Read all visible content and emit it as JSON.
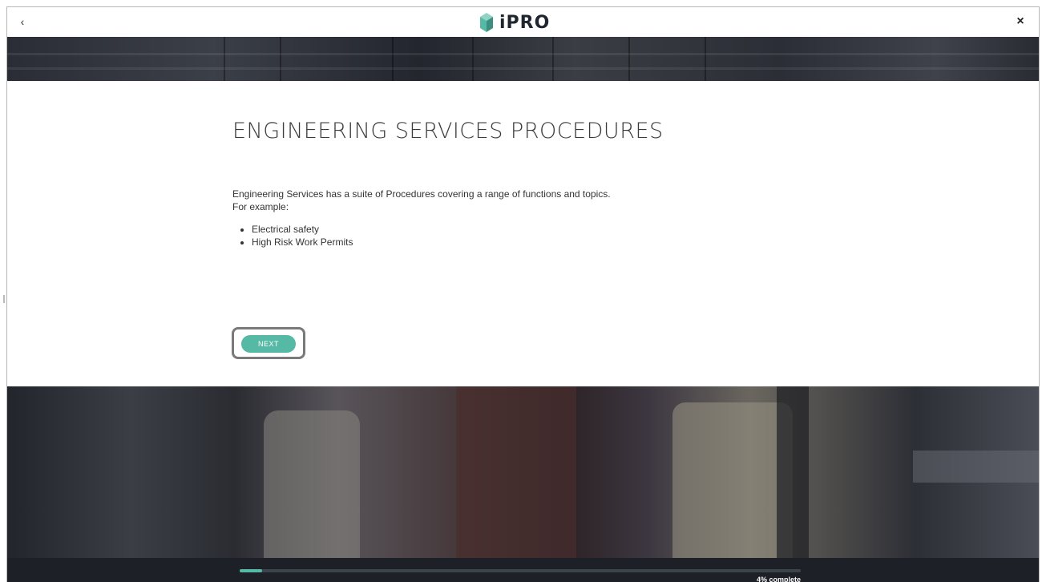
{
  "header": {
    "back_icon": "‹",
    "close_icon": "×",
    "logo_text": "iPRO",
    "logo_color": "#55b9a5"
  },
  "content": {
    "title": "ENGINEERING SERVICES PROCEDURES",
    "intro_line_1": "Engineering Services has a suite of Procedures covering a range of functions and topics.",
    "intro_line_2": "For example:",
    "bullets": [
      "Electrical safety",
      "High Risk Work Permits"
    ],
    "next_label": "NEXT"
  },
  "footer": {
    "progress_percent": 4,
    "progress_label": "4% complete",
    "accent": "#55b9a5"
  }
}
